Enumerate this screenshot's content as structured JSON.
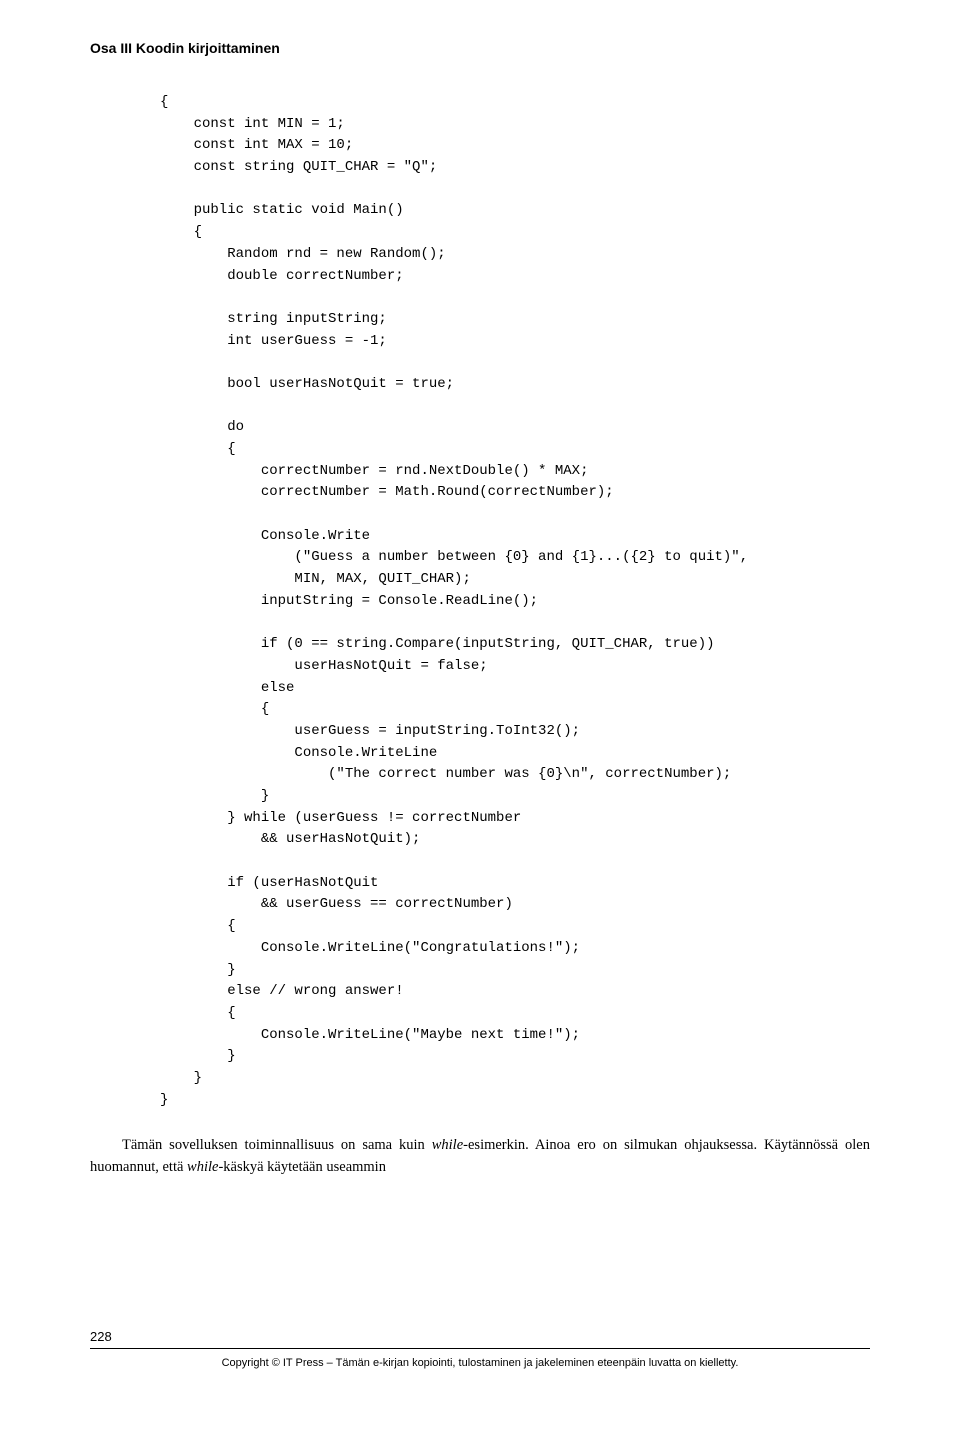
{
  "header": "Osa III   Koodin kirjoittaminen",
  "code": "{\n    const int MIN = 1;\n    const int MAX = 10;\n    const string QUIT_CHAR = \"Q\";\n\n    public static void Main()\n    {\n        Random rnd = new Random();\n        double correctNumber;\n\n        string inputString;\n        int userGuess = -1;\n\n        bool userHasNotQuit = true;\n\n        do\n        {\n            correctNumber = rnd.NextDouble() * MAX;\n            correctNumber = Math.Round(correctNumber);\n\n            Console.Write\n                (\"Guess a number between {0} and {1}...({2} to quit)\",\n                MIN, MAX, QUIT_CHAR);\n            inputString = Console.ReadLine();\n\n            if (0 == string.Compare(inputString, QUIT_CHAR, true))\n                userHasNotQuit = false;\n            else\n            {\n                userGuess = inputString.ToInt32();\n                Console.WriteLine\n                    (\"The correct number was {0}\\n\", correctNumber);\n            }\n        } while (userGuess != correctNumber\n            && userHasNotQuit);\n\n        if (userHasNotQuit\n            && userGuess == correctNumber)\n        {\n            Console.WriteLine(\"Congratulations!\");\n        }\n        else // wrong answer!\n        {\n            Console.WriteLine(\"Maybe next time!\");\n        }\n    }\n}",
  "paragraph_prefix": "Tämän sovelluksen toiminnallisuus on sama kuin ",
  "paragraph_italic1": "while",
  "paragraph_mid": "-esimerkin. Ainoa ero on silmukan ohjauksessa. Käytännössä olen huomannut, että ",
  "paragraph_italic2": "while",
  "paragraph_suffix": "-käskyä käytetään useammin",
  "page_number": "228",
  "copyright": "Copyright © IT Press – Tämän e-kirjan kopiointi, tulostaminen ja jakeleminen eteenpäin luvatta on kielletty."
}
